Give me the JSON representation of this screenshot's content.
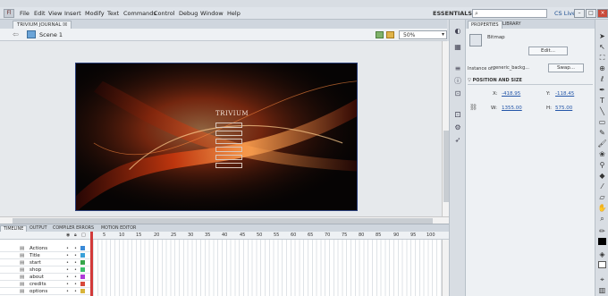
{
  "menubar": {
    "logo": "Fl",
    "items": [
      "File",
      "Edit",
      "View",
      "Insert",
      "Modify",
      "Text",
      "Commands",
      "Control",
      "Debug",
      "Window",
      "Help"
    ],
    "workspace": "ESSENTIALS ▾",
    "cs_live": "CS Live"
  },
  "document": {
    "tab_label": "TRIVIUM JOURNAL ☒",
    "scene_label": "Scene 1",
    "zoom": "50%"
  },
  "stage": {
    "title": "TRIVIUM",
    "menu_buttons": 6,
    "colors": {
      "dark": "#060404",
      "flare": "#e0481a",
      "glow": "#ffb070"
    }
  },
  "timeline": {
    "tabs": [
      "TIMELINE",
      "OUTPUT",
      "COMPILER ERRORS",
      "MOTION EDITOR"
    ],
    "frame_numbers": [
      "5",
      "10",
      "15",
      "20",
      "25",
      "30",
      "35",
      "40",
      "45",
      "50",
      "55",
      "60",
      "65",
      "70",
      "75",
      "80",
      "85",
      "90",
      "95",
      "100"
    ],
    "layers": [
      {
        "name": "Actions",
        "color": "#3a8ad8"
      },
      {
        "name": "Title",
        "color": "#3aa0d8"
      },
      {
        "name": "start",
        "color": "#35a64a"
      },
      {
        "name": "shop",
        "color": "#3ac06a"
      },
      {
        "name": "about",
        "color": "#b03ad8"
      },
      {
        "name": "credits",
        "color": "#d84a3a"
      },
      {
        "name": "options",
        "color": "#d8b43a"
      }
    ]
  },
  "properties": {
    "tabs": [
      "PROPERTIES",
      "LIBRARY"
    ],
    "type_label": "Bitmap",
    "edit_button": "Edit...",
    "instance_label": "Instance of:",
    "instance_name": "generic_backg...",
    "swap_button": "Swap...",
    "section_title": "▽ POSITION AND SIZE",
    "x_label": "X:",
    "x_value": "-418.95",
    "y_label": "Y:",
    "y_value": "-118.45",
    "w_label": "W:",
    "w_value": "1355.00",
    "h_label": "H:",
    "h_value": "575.00"
  }
}
